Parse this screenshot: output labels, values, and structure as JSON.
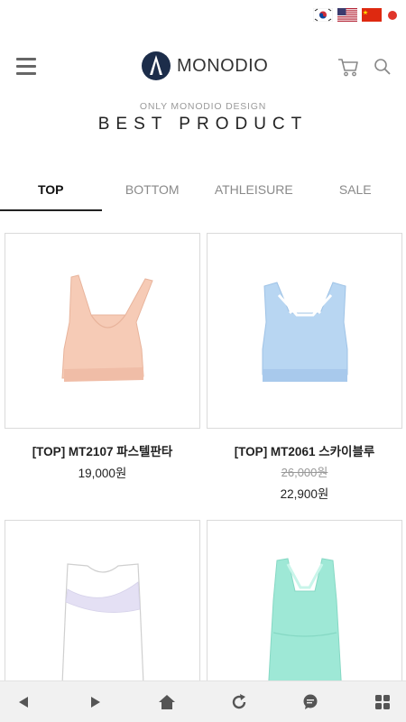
{
  "header": {
    "brand": "MONODIO",
    "flags": [
      "korea-flag-icon",
      "usa-flag-icon",
      "china-flag-icon",
      "japan-flag-icon"
    ]
  },
  "section": {
    "subtitle": "ONLY MONODIO DESIGN",
    "title": "BEST PRODUCT"
  },
  "tabs": [
    {
      "label": "TOP",
      "active": true
    },
    {
      "label": "BOTTOM",
      "active": false
    },
    {
      "label": "ATHLEISURE",
      "active": false
    },
    {
      "label": "SALE",
      "active": false
    }
  ],
  "products": [
    {
      "name": "[TOP] MT2107 파스텔판타",
      "price": "19,000원",
      "color": "#f6cbb6"
    },
    {
      "name": "[TOP] MT2061 스카이블루",
      "old_price": "26,000원",
      "price": "22,900원",
      "color": "#b8d6f2"
    },
    {
      "name": "",
      "color": "#ffffff"
    },
    {
      "name": "",
      "color": "#9ee8d6"
    }
  ],
  "bottom_nav": [
    "back-icon",
    "forward-icon",
    "home-icon",
    "refresh-icon",
    "chat-icon",
    "grid-menu-icon"
  ],
  "colors": {
    "accent": "#222222",
    "tab_inactive": "#8a8a8a",
    "bar_bg": "#f1f1f1",
    "icon": "#555555"
  }
}
